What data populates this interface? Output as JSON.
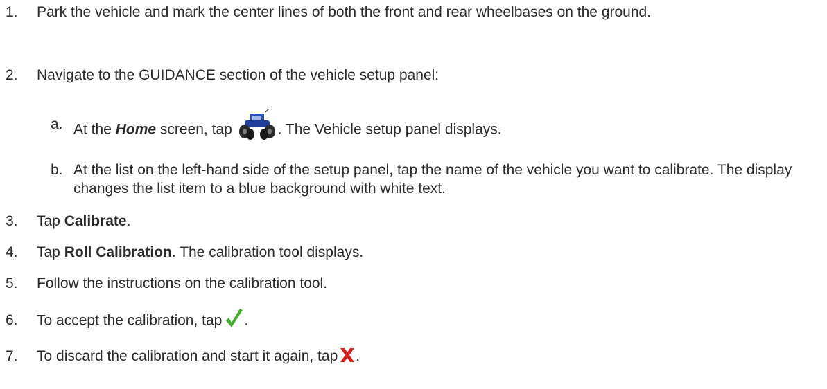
{
  "steps": [
    {
      "num": "1.",
      "text": "Park the vehicle and mark the center lines of both the front and rear wheelbases on the ground."
    },
    {
      "num": "2.",
      "text": "Navigate to the GUIDANCE section of the vehicle setup panel:"
    },
    {
      "num": "a.",
      "pre": "At the ",
      "home": "Home",
      "mid": " screen, tap ",
      "post": ". The Vehicle setup panel displays.",
      "icon": "tractor-icon"
    },
    {
      "num": "b.",
      "text": "At the list on the left-hand side of the setup panel, tap the name of the vehicle you want to calibrate. The display changes the list item to a blue background with white text."
    },
    {
      "num": "3.",
      "pre": "Tap ",
      "bold": "Calibrate",
      "post": "."
    },
    {
      "num": "4.",
      "pre": "Tap ",
      "bold": "Roll Calibration",
      "post": ". The calibration tool displays."
    },
    {
      "num": "5.",
      "text": "Follow the instructions on the calibration tool."
    },
    {
      "num": "6.",
      "text": "To accept the calibration, tap",
      "post": ".",
      "icon": "checkmark-icon"
    },
    {
      "num": "7.",
      "text": "To discard the calibration and start it again, tap",
      "post": ".",
      "icon": "x-icon"
    }
  ],
  "colors": {
    "text": "#2b2b2b",
    "check": "#3fae2a",
    "x": "#d61f1f",
    "tractor": "#1f3f9a"
  }
}
